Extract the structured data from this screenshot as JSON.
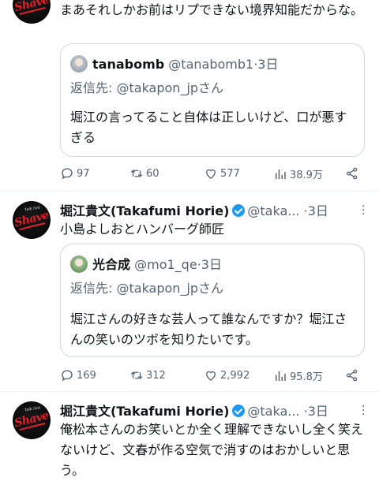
{
  "tweet1": {
    "text": "まあそれしかお前はリプできない境界知能だからな。",
    "quote": {
      "name": "tanabomb",
      "handle": "@tanabomb1",
      "time": "3日",
      "reply_prefix": "返信先: ",
      "reply_handle": "@takapon_jp",
      "reply_suffix": "さん",
      "text": "堀江の言ってること自体は正しいけど、口が悪すぎる"
    },
    "stats": {
      "replies": "97",
      "retweets": "60",
      "likes": "577",
      "views": "38.9万"
    }
  },
  "tweet2": {
    "name": "堀江貴文(Takafumi Horie)",
    "handle": "@taka...",
    "time": "3日",
    "text": "小島よしおとハンバーグ師匠",
    "quote": {
      "name": "光合成",
      "handle": "@mo1_qe",
      "time": "3日",
      "reply_prefix": "返信先: ",
      "reply_handle": "@takapon_jp",
      "reply_suffix": "さん",
      "text": "堀江さんの好きな芸人って誰なんですか？堀江さんの笑いのツボを知りたいです。"
    },
    "stats": {
      "replies": "169",
      "retweets": "312",
      "likes": "2,992",
      "views": "95.8万"
    }
  },
  "tweet3": {
    "name": "堀江貴文(Takafumi Horie)",
    "handle": "@taka...",
    "time": "3日",
    "text": "俺松本さんのお笑いとか全く理解できないし全く笑えないけど、文春が作る空気で消すのはおかしいと思う。"
  },
  "avatar": {
    "logo_text": "Shave",
    "logo_small": "Talk live"
  },
  "separator": "·",
  "colors": {
    "verified": "#1d9bf0",
    "secondary": "#536471",
    "border": "#cfd9de"
  }
}
